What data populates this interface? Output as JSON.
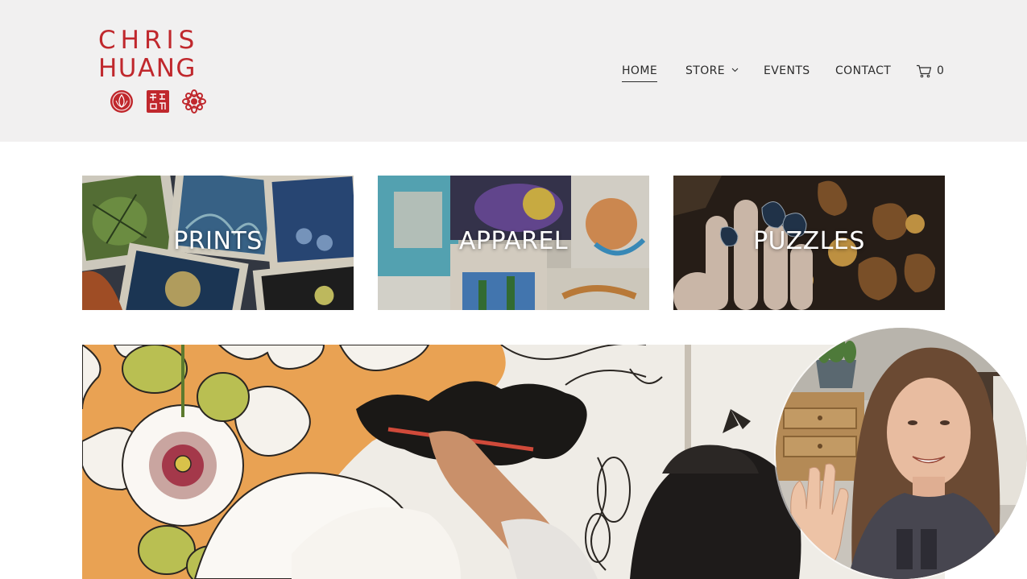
{
  "brand": {
    "line1": "CHRIS",
    "line2": "HUANG",
    "color": "#c0282d",
    "seals": [
      "lotus-seal-icon",
      "chinese-seal-icon",
      "mandala-seal-icon"
    ]
  },
  "nav": {
    "items": [
      {
        "label": "HOME",
        "active": true
      },
      {
        "label": "STORE",
        "has_dropdown": true
      },
      {
        "label": "EVENTS"
      },
      {
        "label": "CONTACT"
      }
    ],
    "cart": {
      "icon": "cart-icon",
      "count": "0"
    }
  },
  "tiles": [
    {
      "label": "PRINTS"
    },
    {
      "label": "APPAREL"
    },
    {
      "label": "PUZZLES"
    }
  ],
  "hero": {
    "description_icon": "mural-painting-image"
  },
  "webcam": {
    "icon": "webcam-overlay-image"
  },
  "colors": {
    "header_bg": "#f1f0f0",
    "text": "#2b2b2b",
    "accent": "#c0282d"
  }
}
